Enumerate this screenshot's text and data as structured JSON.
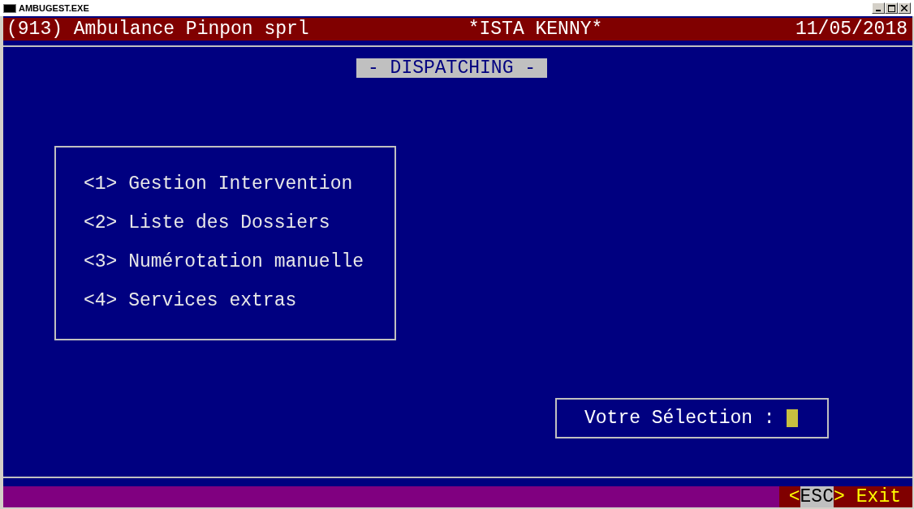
{
  "window": {
    "title": "AMBUGEST.EXE"
  },
  "header": {
    "company": "(913) Ambulance Pinpon sprl",
    "user": "*ISTA KENNY*",
    "date": "11/05/2018"
  },
  "screen_title": "- DISPATCHING -",
  "menu": [
    {
      "text": "<1> Gestion Intervention"
    },
    {
      "text": "<2> Liste des Dossiers"
    },
    {
      "text": "<3> Numérotation manuelle"
    },
    {
      "text": "<4> Services extras"
    }
  ],
  "prompt": {
    "label": "Votre Sélection :"
  },
  "footer": {
    "open": "<",
    "key": "ESC",
    "close": ">",
    "label": "Exit"
  }
}
